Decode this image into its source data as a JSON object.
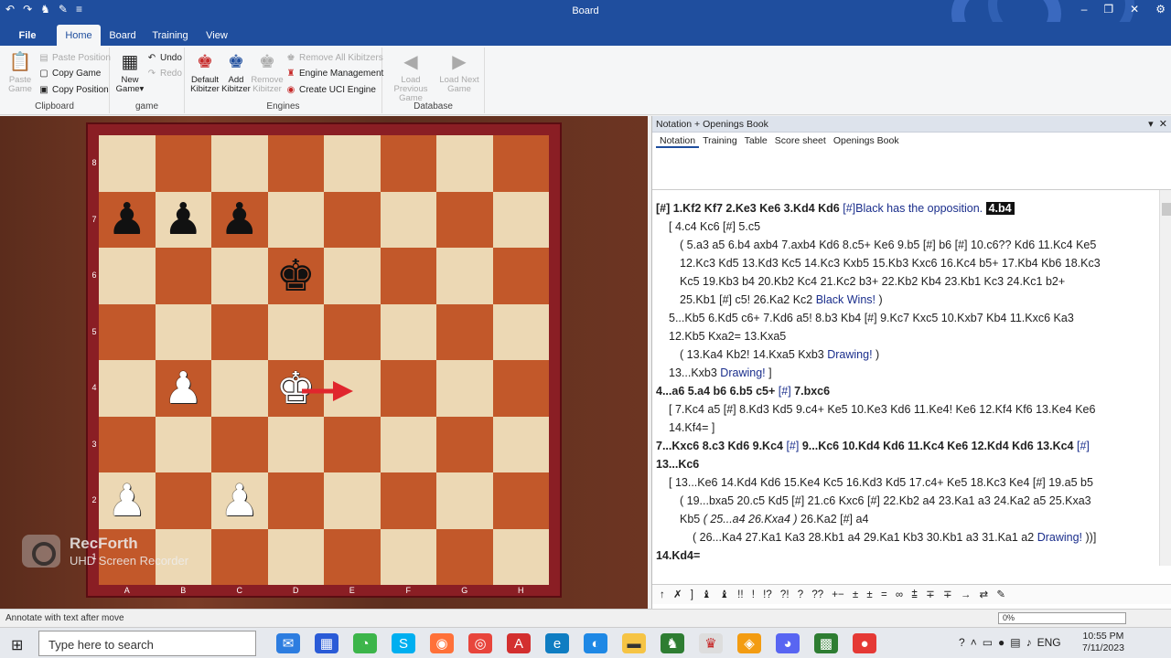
{
  "window": {
    "title": "Board"
  },
  "tabs": {
    "file": "File",
    "home": "Home",
    "board": "Board",
    "training": "Training",
    "view": "View"
  },
  "ribbon": {
    "clipboard": {
      "label": "Clipboard",
      "paste_game": "Paste Game",
      "paste_position": "Paste Position",
      "copy_game": "Copy Game",
      "copy_position": "Copy Position"
    },
    "game": {
      "label": "game",
      "new_game": "New Game",
      "undo": "Undo",
      "redo": "Redo"
    },
    "engines": {
      "label": "Engines",
      "default_kibitzer": "Default Kibitzer",
      "add_kibitzer": "Add Kibitzer",
      "remove_kibitzer": "Remove Kibitzer",
      "remove_all_kibitzers": "Remove All Kibitzers",
      "engine_management": "Engine Management",
      "create_uci_engine": "Create UCI Engine"
    },
    "database": {
      "label": "Database",
      "load_previous": "Load Previous Game",
      "load_next": "Load Next Game"
    }
  },
  "board": {
    "files": [
      "A",
      "B",
      "C",
      "D",
      "E",
      "F",
      "G",
      "H"
    ],
    "ranks": [
      "8",
      "7",
      "6",
      "5",
      "4",
      "3",
      "2",
      "1"
    ],
    "squares": [
      [
        "",
        "",
        "",
        "",
        "",
        "",
        "",
        ""
      ],
      [
        "♟",
        "♟",
        "♟",
        "",
        "",
        "",
        "",
        ""
      ],
      [
        "",
        "",
        "",
        "♚",
        "",
        "",
        "",
        ""
      ],
      [
        "",
        "",
        "",
        "",
        "",
        "",
        "",
        ""
      ],
      [
        "",
        "♙",
        "",
        "♔",
        "",
        "",
        "",
        ""
      ],
      [
        "",
        "",
        "",
        "",
        "",
        "",
        "",
        ""
      ],
      [
        "♙",
        "",
        "♙",
        "",
        "",
        "",
        "",
        ""
      ],
      [
        "",
        "",
        "",
        "",
        "",
        "",
        "",
        ""
      ]
    ],
    "colors": [
      "",
      "",
      "",
      "",
      "",
      "",
      "",
      ""
    ],
    "light_color": "#ecd8b4",
    "dark_color": "#c2582a",
    "arrow_color": "#e0262d"
  },
  "watermark": {
    "line1": "RecForth",
    "line2": "UHD Screen Recorder"
  },
  "notation": {
    "panel_title": "Notation + Openings Book",
    "tabs": [
      "Notation",
      "Training",
      "Table",
      "Score sheet",
      "Openings Book"
    ],
    "lines": [
      {
        "indent": 0,
        "main": true,
        "html": "[#]  1.Kf2  Kf7  2.Ke3  Ke6  3.Kd4  Kd6 <span class=\"cm\">[#]Black has the opposition.</span> <span class=\"hl\">4.b4</span>"
      },
      {
        "indent": 14,
        "main": false,
        "html": "[ 4.c4  Kc6 [#]  5.c5"
      },
      {
        "indent": 26,
        "main": false,
        "html": "( 5.a3  a5  6.b4  axb4  7.axb4  Kd6  8.c5+  Ke6  9.b5 [#]  b6 [#]  10.c6??  Kd6  11.Kc4  Ke5"
      },
      {
        "indent": 26,
        "main": false,
        "html": "12.Kc3  Kd5  13.Kd3  Kc5  14.Kc3  Kxb5  15.Kb3  Kxc6  16.Kc4  b5+  17.Kb4  Kb6  18.Kc3"
      },
      {
        "indent": 26,
        "main": false,
        "html": "Kc5  19.Kb3  b4  20.Kb2  Kc4  21.Kc2  b3+  22.Kb2  Kb4  23.Kb1  Kc3  24.Kc1  b2+"
      },
      {
        "indent": 26,
        "main": false,
        "html": "25.Kb1 [#]  c5!  26.Ka2  Kc2 <span class=\"cm\">Black Wins!</span> )"
      },
      {
        "indent": 14,
        "main": false,
        "html": "5...Kb5  6.Kd5  c6+  7.Kd6  a5!  8.b3  Kb4 [#]  9.Kc7  Kxc5  10.Kxb7  Kb4  11.Kxc6  Ka3"
      },
      {
        "indent": 14,
        "main": false,
        "html": "12.Kb5  Kxa2=  13.Kxa5"
      },
      {
        "indent": 26,
        "main": false,
        "html": "( 13.Ka4  Kb2!  14.Kxa5  Kxb3 <span class=\"cm\">Drawing!</span> )"
      },
      {
        "indent": 14,
        "main": false,
        "html": "13...Kxb3 <span class=\"cm\">Drawing!</span> ]"
      },
      {
        "indent": 0,
        "main": true,
        "html": "4...a6  5.a4  b6  6.b5  c5+ <span class=\"cm\">[#]</span>  7.bxc6"
      },
      {
        "indent": 14,
        "main": false,
        "html": "[ 7.Kc4  a5 [#]  8.Kd3  Kd5  9.c4+  Ke5  10.Ke3  Kd6  11.Ke4!  Ke6  12.Kf4  Kf6  13.Ke4  Ke6"
      },
      {
        "indent": 14,
        "main": false,
        "html": "14.Kf4= ]"
      },
      {
        "indent": 0,
        "main": true,
        "html": "7...Kxc6  8.c3  Kd6  9.Kc4 <span class=\"cm\">[#]</span>  9...Kc6  10.Kd4  Kd6  11.Kc4  Ke6  12.Kd4  Kd6  13.Kc4 <span class=\"cm\">[#]</span>"
      },
      {
        "indent": 0,
        "main": true,
        "html": "13...Kc6"
      },
      {
        "indent": 14,
        "main": false,
        "html": "[ 13...Ke6  14.Kd4  Kd6  15.Ke4  Kc5  16.Kd3  Kd5  17.c4+  Ke5  18.Kc3  Ke4 [#]  19.a5  b5"
      },
      {
        "indent": 26,
        "main": false,
        "html": "( 19...bxa5  20.c5  Kd5 [#]  21.c6  Kxc6 [#]  22.Kb2  a4  23.Ka1  a3  24.Ka2  a5  25.Kxa3"
      },
      {
        "indent": 26,
        "main": false,
        "html": "Kb5  <i>( 25...a4  26.Kxa4 )</i>  26.Ka2 [#]  a4"
      },
      {
        "indent": 40,
        "main": false,
        "html": "( 26...Ka4  27.Ka1  Ka3  28.Kb1  a4  29.Ka1  Kb3  30.Kb1  a3  31.Ka1  a2 <span class=\"cm\">Drawing!</span> ))]"
      },
      {
        "indent": 0,
        "main": true,
        "html": "14.Kd4="
      }
    ],
    "symbols": "↑ ✗ ] ♝ ♝ !! ! !? ?! ? ?? +− ± ± = ∞ ⩲ ∓ ∓ → ⇄ ✎"
  },
  "status": {
    "text": "Annotate with text after move",
    "zoom": "0%"
  },
  "taskbar": {
    "search_placeholder": "Type here to search",
    "time": "10:55 PM",
    "date": "7/11/2023",
    "lang": "ENG"
  }
}
